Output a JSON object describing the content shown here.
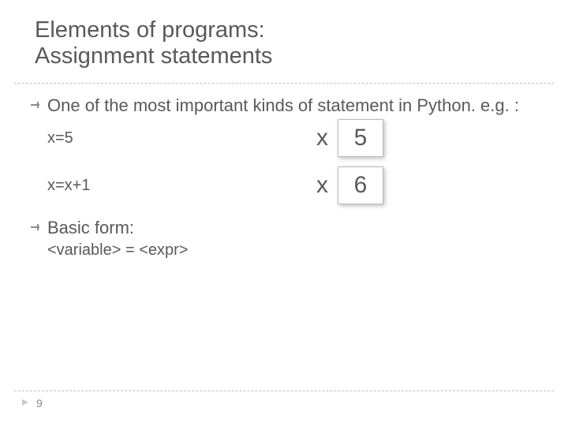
{
  "title": {
    "line1": "Elements of programs:",
    "line2": "Assignment statements"
  },
  "bullets": [
    {
      "text": "One of the most important kinds of statement in Python. e.g. :",
      "examples": [
        {
          "code": "x=5",
          "var": "x",
          "value": "5"
        },
        {
          "code": "x=x+1",
          "var": "x",
          "value": "6"
        }
      ]
    },
    {
      "text": "Basic form:",
      "sub": "<variable> = <expr>"
    }
  ],
  "page_number": "9"
}
